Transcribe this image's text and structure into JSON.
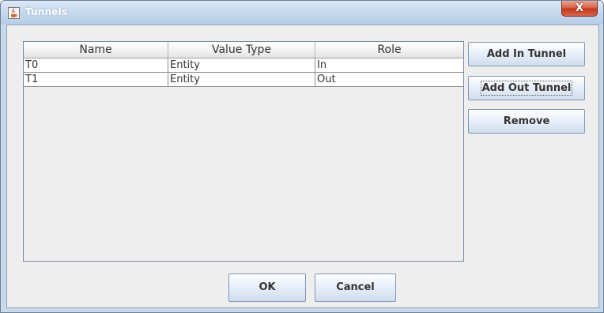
{
  "window": {
    "title": "Tunnels",
    "close_glyph": "X",
    "icon": "java-cup-icon"
  },
  "table": {
    "columns": [
      "Name",
      "Value Type",
      "Role"
    ],
    "rows": [
      [
        "T0",
        "Entity",
        "In"
      ],
      [
        "T1",
        "Entity",
        "Out"
      ]
    ]
  },
  "side_buttons": {
    "add_in": "Add In Tunnel",
    "add_out": "Add Out Tunnel",
    "remove": "Remove"
  },
  "footer": {
    "ok": "OK",
    "cancel": "Cancel"
  }
}
